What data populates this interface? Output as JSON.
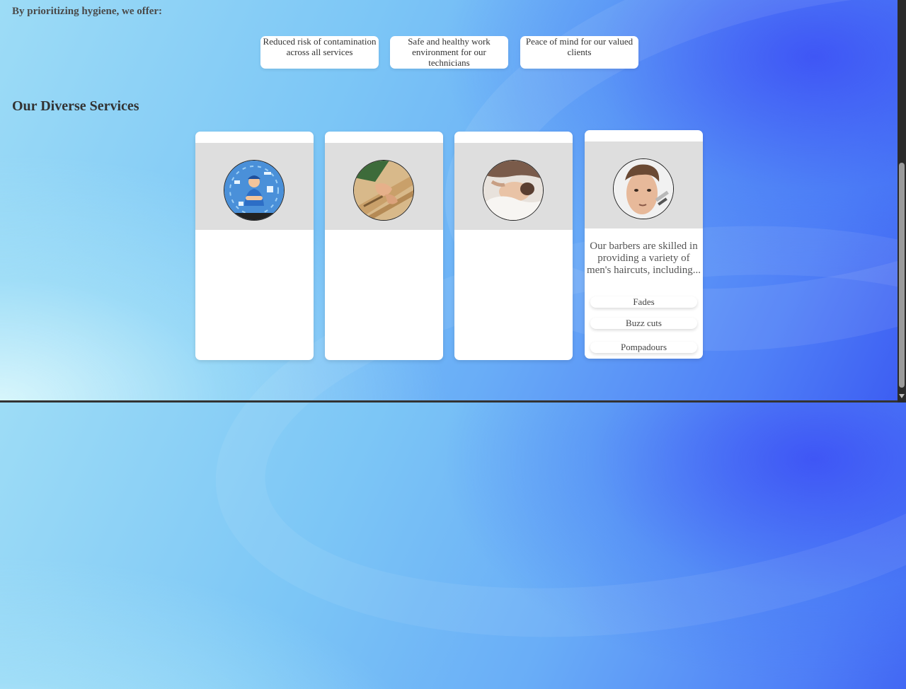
{
  "intro": {
    "text": "By prioritizing hygiene, we offer:"
  },
  "benefits": [
    {
      "text": "Reduced risk of contamination across all services"
    },
    {
      "text": "Safe and healthy work environment for our technicians"
    },
    {
      "text": "Peace of mind for our valued clients"
    }
  ],
  "services": {
    "title": "Our Diverse Services",
    "cards": [
      {
        "image": "plumbing-technician-image"
      },
      {
        "image": "carpentry-image"
      },
      {
        "image": "spa-massage-image"
      },
      {
        "image": "barber-shaving-image",
        "description": "Our barbers are skilled in providing a variety of men's haircuts, including...",
        "options": [
          "Fades",
          "Buzz cuts",
          "Pompadours"
        ]
      }
    ]
  },
  "colors": {
    "card_background": "#ffffff",
    "media_background": "#dedede",
    "text_dark": "#333333",
    "scrollbar_track": "#2a2a2a",
    "scrollbar_thumb": "#9b9b9b"
  }
}
